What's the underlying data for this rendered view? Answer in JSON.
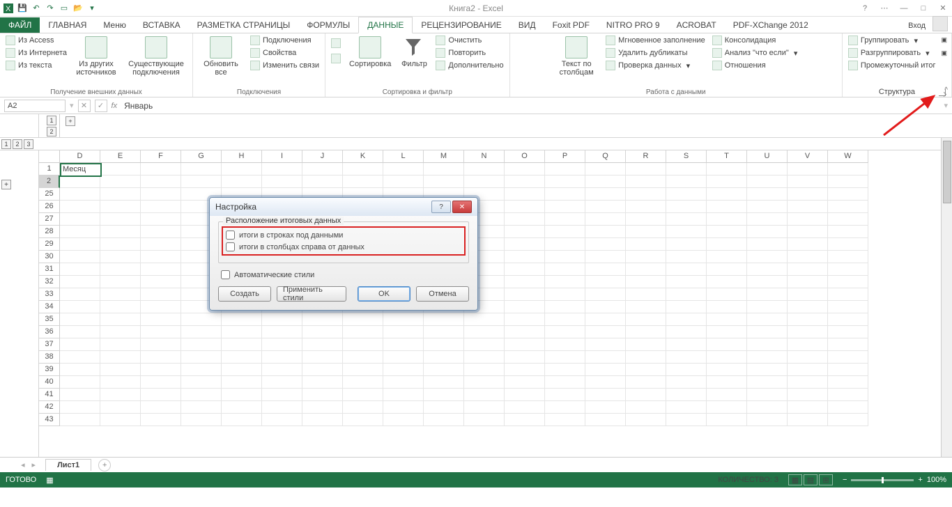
{
  "title": "Книга2 - Excel",
  "qat": {
    "items": [
      "excel",
      "save",
      "undo",
      "redo",
      "new",
      "open",
      "touch"
    ]
  },
  "win": {
    "help": "?",
    "opts": "⋯",
    "min": "—",
    "max": "□",
    "close": "✕"
  },
  "tabs": {
    "file": "ФАЙЛ",
    "list": [
      "ГЛАВНАЯ",
      "Меню",
      "ВСТАВКА",
      "РАЗМЕТКА СТРАНИЦЫ",
      "ФОРМУЛЫ",
      "ДАННЫЕ",
      "РЕЦЕНЗИРОВАНИЕ",
      "ВИД",
      "Foxit PDF",
      "NITRO PRO 9",
      "ACROBAT",
      "PDF-XChange 2012"
    ],
    "active": "ДАННЫЕ",
    "signin": "Вход"
  },
  "ribbon": {
    "g1": {
      "access": "Из Access",
      "web": "Из Интернета",
      "text": "Из текста",
      "other": "Из других источников",
      "existing": "Существующие подключения",
      "label": "Получение внешних данных"
    },
    "g2": {
      "refresh": "Обновить все",
      "conn": "Подключения",
      "props": "Свойства",
      "links": "Изменить связи",
      "label": "Подключения"
    },
    "g3": {
      "sort": "Сортировка",
      "filter": "Фильтр",
      "clear": "Очистить",
      "reapply": "Повторить",
      "adv": "Дополнительно",
      "label": "Сортировка и фильтр"
    },
    "g4": {
      "ttc": "Текст по столбцам",
      "flash": "Мгновенное заполнение",
      "dup": "Удалить дубликаты",
      "valid": "Проверка данных",
      "consol": "Консолидация",
      "whatif": "Анализ \"что если\"",
      "rel": "Отношения",
      "label": "Работа с данными"
    },
    "g5": {
      "group": "Группировать",
      "ungroup": "Разгруппировать",
      "subtotal": "Промежуточный итог",
      "label": "Структура"
    }
  },
  "formula": {
    "cell": "A2",
    "value": "Январь"
  },
  "outline": {
    "cols": [
      "1",
      "2"
    ],
    "rows": [
      "1",
      "2",
      "3"
    ],
    "plus": "+"
  },
  "grid": {
    "cols": [
      "D",
      "E",
      "F",
      "G",
      "H",
      "I",
      "J",
      "K",
      "L",
      "M",
      "N",
      "O",
      "P",
      "Q",
      "R",
      "S",
      "T",
      "U",
      "V",
      "W"
    ],
    "rows": [
      "1",
      "2",
      "25",
      "26",
      "27",
      "28",
      "29",
      "30",
      "31",
      "32",
      "33",
      "34",
      "35",
      "36",
      "37",
      "38",
      "39",
      "40",
      "41",
      "42",
      "43"
    ],
    "a2": "Месяц"
  },
  "sheet": {
    "name": "Лист1",
    "add": "+"
  },
  "status": {
    "ready": "ГОТОВО",
    "count_label": "КОЛИЧЕСТВО:",
    "count": "3",
    "zoom": "100%"
  },
  "dialog": {
    "title": "Настройка",
    "groupbox": "Расположение итоговых данных",
    "opt1": "итоги в строках под данными",
    "opt2": "итоги в столбцах справа от данных",
    "auto": "Автоматические стили",
    "create": "Создать",
    "apply": "Применить стили",
    "ok": "OK",
    "cancel": "Отмена",
    "help": "?",
    "close": "✕"
  }
}
